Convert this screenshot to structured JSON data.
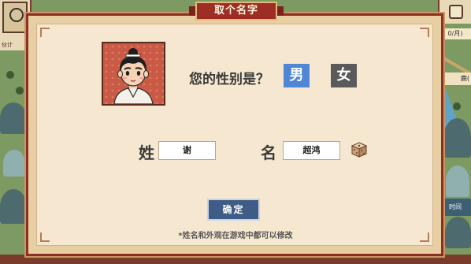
{
  "dialog": {
    "title": "取个名字",
    "gender_question": "您的性别是？",
    "gender_options": {
      "male": "男",
      "female": "女"
    },
    "selected_gender": "male",
    "surname_label": "姓",
    "surname_value": "谢",
    "given_name_label": "名",
    "given_name_value": "超鸿",
    "confirm_label": "确定",
    "footnote": "*姓名和外观在游戏中都可以修改"
  },
  "hud": {
    "left_tag": "伙计",
    "date_fragment": "0/月)",
    "side_label_fragment": "鹿(",
    "time_button_fragment": "时间"
  },
  "colors": {
    "dialog_border": "#8d2f23",
    "panel_bg": "#f6e8d0",
    "male_button": "#4f86d6",
    "female_button": "#5a5a5a",
    "confirm_button": "#3e5c85"
  },
  "icons": {
    "random_name": "dice-icon",
    "portrait": "character-portrait"
  }
}
